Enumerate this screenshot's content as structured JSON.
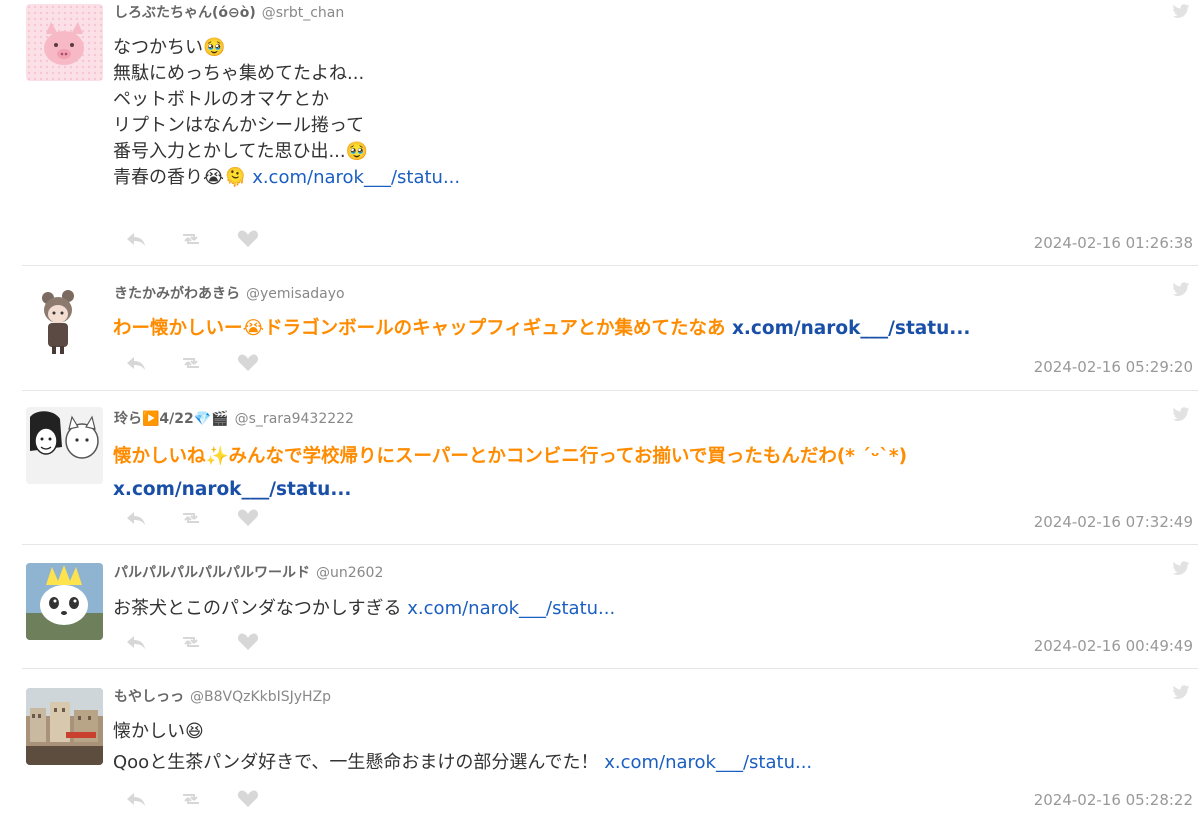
{
  "colors": {
    "accent_text": "#ff8c00",
    "link": "#1a5ec2",
    "icon_gray": "#d7d7d7",
    "timestamp": "#999999"
  },
  "tweets": [
    {
      "name": "しろぶたちゃん(ό⊖ὸ)",
      "handle": "@srbt_chan",
      "lines": [
        "なつかちい🥹",
        "無駄にめっちゃ集めてたよね...",
        "ペットボトルのオマケとか",
        "リプトンはなんかシール捲って",
        "番号入力とかしてた思ひ出...🥹",
        "青春の香り😭🫠"
      ],
      "link": "x.com/narok___/statu...",
      "timestamp": "2024-02-16 01:26:38"
    },
    {
      "name": "きたかみがわあきら",
      "handle": "@yemisadayo",
      "text": "わー懐かしいー😭ドラゴンボールのキャップフィギュアとか集めてたなあ",
      "link": "x.com/narok___/statu...",
      "timestamp": "2024-02-16 05:29:20"
    },
    {
      "name": "玲ら▶️4/22💎🎬",
      "handle": "@s_rara9432222",
      "text": "懐かしいね✨みんなで学校帰りにスーパーとかコンビニ行ってお揃いで買ったもんだわ(* ´ᵕ`*)",
      "link": "x.com/narok___/statu...",
      "timestamp": "2024-02-16 07:32:49"
    },
    {
      "name": "パルパルパルパルパルワールド",
      "handle": "@un2602",
      "text": "お茶犬とこのパンダなつかしすぎる",
      "link": "x.com/narok___/statu...",
      "timestamp": "2024-02-16 00:49:49"
    },
    {
      "name": "もやしっっ",
      "handle": "@B8VQzKkbISJyHZp",
      "lines": [
        "懐かしい😆",
        "Qooと生茶パンダ好きで、一生懸命おまけの部分選んでた！"
      ],
      "link": "x.com/narok___/statu...",
      "timestamp": "2024-02-16 05:28:22"
    }
  ],
  "icons": {
    "reply": "reply-icon",
    "retweet": "retweet-icon",
    "like": "heart-icon",
    "source": "twitter-bird-icon"
  }
}
